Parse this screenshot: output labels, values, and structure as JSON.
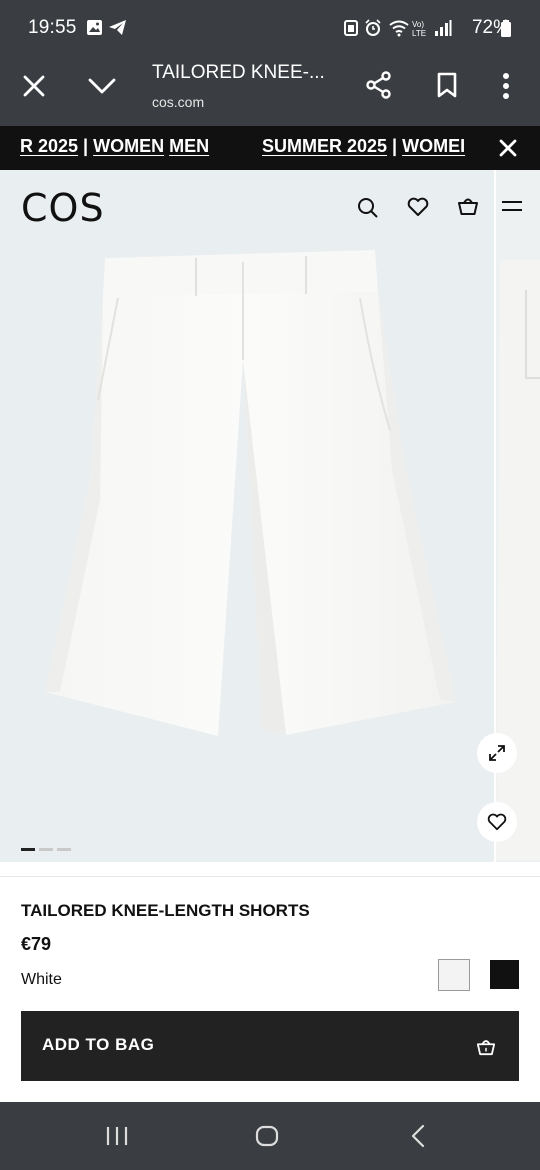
{
  "status_bar": {
    "time": "19:55",
    "battery": "72%"
  },
  "browser": {
    "page_title": "TAILORED KNEE-...",
    "url": "cos.com"
  },
  "ticker": {
    "segment1_part1": "R 2025",
    "segment1_sep": " | ",
    "segment1_link1": "WOMEN",
    "segment1_link2": "MEN",
    "segment2_part1": "SUMMER 2025",
    "segment2_sep": " | ",
    "segment2_link1": "WOMEI"
  },
  "site": {
    "logo": "COS"
  },
  "gallery": {
    "current_index": 1,
    "total": 3
  },
  "product": {
    "name": "TAILORED KNEE-LENGTH SHORTS",
    "price": "€79",
    "color": "White",
    "swatches": [
      "#f3f3f3",
      "#111111"
    ],
    "add_to_bag_label": "ADD TO BAG"
  }
}
